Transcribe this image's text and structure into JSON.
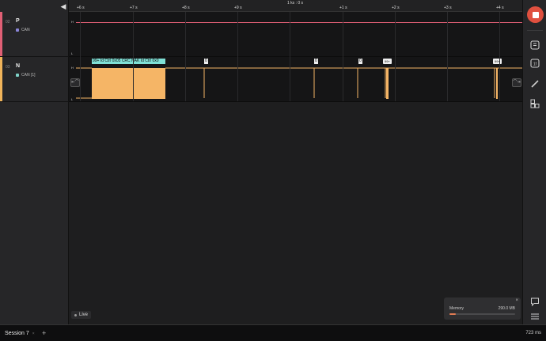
{
  "channels": [
    {
      "num": "02",
      "name": "P",
      "protocol": "CAN",
      "strip_color": "#e05f75",
      "dot_color": "#8a85d8",
      "trace_color": "#e05f75"
    },
    {
      "num": "03",
      "name": "N",
      "protocol": "CAN [1]",
      "strip_color": "#f0b45a",
      "dot_color": "#7fd3c8",
      "trace_color": "#f5b566"
    }
  ],
  "ruler": {
    "center": "1 ks : 0 s",
    "ticks": [
      "+6 s",
      "+7 s",
      "+8 s",
      "+9 s",
      "+1 s",
      "+2 s",
      "+3 s",
      "+4 s"
    ]
  },
  "levels": {
    "high": "H",
    "low": "L"
  },
  "annotations": {
    "main_packet": "99+ Id Ctrl 0x05 CRC NAK Id Ctrl 0x0",
    "markers": [
      "0",
      "0",
      "0",
      "99+",
      "99+"
    ],
    "left_nav": "⇤⌒",
    "right_nav": "⌒⇥"
  },
  "live_label": "Live",
  "memory": {
    "label": "Memory",
    "value": "290.0 MB",
    "close": "×",
    "usage_fraction": 0.1
  },
  "session": {
    "tab_label": "Session 7",
    "close": "×",
    "add": "+"
  },
  "status": "723 ms",
  "colors": {
    "accent": "#e0503f",
    "trace_n": "#f5b566",
    "trace_p": "#e05f75",
    "marker": "#7fe0d6"
  }
}
